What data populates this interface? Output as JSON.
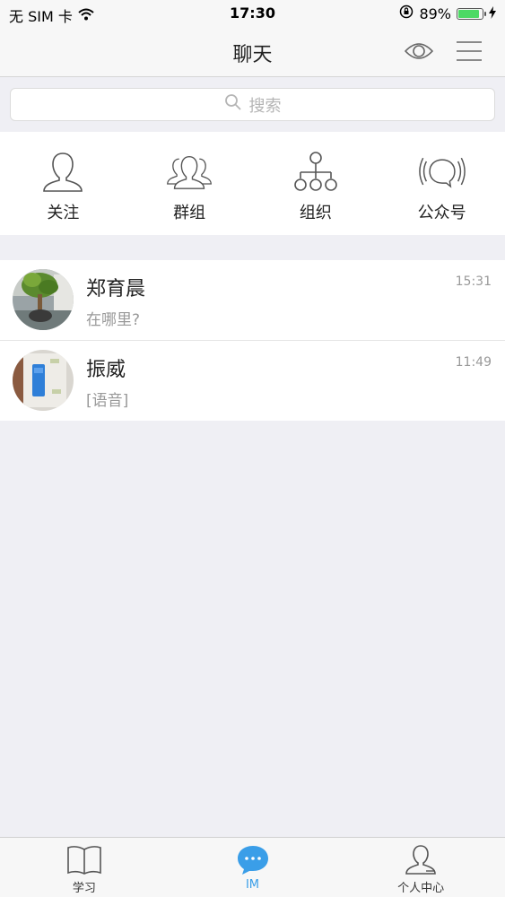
{
  "status_bar": {
    "carrier": "无 SIM 卡",
    "time": "17:30",
    "battery_percent": "89%",
    "battery_level": 0.89
  },
  "nav": {
    "title": "聊天",
    "eye_icon": "eye-icon",
    "menu_icon": "hamburger-menu-icon"
  },
  "search": {
    "placeholder": "搜索",
    "icon": "search-icon"
  },
  "quick_actions": [
    {
      "label": "关注",
      "icon": "person-icon"
    },
    {
      "label": "群组",
      "icon": "group-icon"
    },
    {
      "label": "组织",
      "icon": "org-tree-icon"
    },
    {
      "label": "公众号",
      "icon": "broadcast-icon"
    }
  ],
  "chats": [
    {
      "name": "郑育晨",
      "preview": "在哪里?",
      "time": "15:31"
    },
    {
      "name": "振威",
      "preview": "[语音]",
      "time": "11:49"
    }
  ],
  "tabs": [
    {
      "label": "学习",
      "icon": "book-icon",
      "active": false
    },
    {
      "label": "IM",
      "icon": "chat-bubble-icon",
      "active": true
    },
    {
      "label": "个人中心",
      "icon": "user-icon",
      "active": false
    }
  ],
  "colors": {
    "accent": "#3a9ee8",
    "background": "#efeff4",
    "battery": "#4cd964"
  }
}
